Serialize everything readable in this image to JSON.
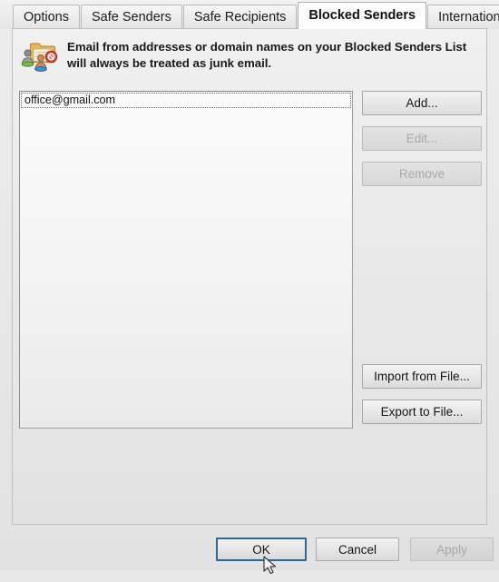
{
  "dialog": {
    "tabs": [
      {
        "label": "Options",
        "selected": false
      },
      {
        "label": "Safe Senders",
        "selected": false
      },
      {
        "label": "Safe Recipients",
        "selected": false
      },
      {
        "label": "Blocked Senders",
        "selected": true
      },
      {
        "label": "International",
        "selected": false
      }
    ],
    "header": {
      "icon": "blocked-senders-folder-icon",
      "description": "Email from addresses or domain names on your Blocked Senders List will always be treated as junk email."
    },
    "listbox": {
      "name": "blocked-senders-list",
      "items": [
        {
          "value": "office@gmail.com",
          "focused": true
        }
      ]
    },
    "side_buttons": [
      {
        "id": "add",
        "label": "Add...",
        "enabled": true
      },
      {
        "id": "edit",
        "label": "Edit...",
        "enabled": false
      },
      {
        "id": "remove",
        "label": "Remove",
        "enabled": false
      },
      {
        "id": "import",
        "label": "Import from File...",
        "enabled": true
      },
      {
        "id": "export",
        "label": "Export to File...",
        "enabled": true
      }
    ],
    "footer_buttons": [
      {
        "id": "ok",
        "label": "OK",
        "enabled": true,
        "default": true
      },
      {
        "id": "cancel",
        "label": "Cancel",
        "enabled": true,
        "default": false
      },
      {
        "id": "apply",
        "label": "Apply",
        "enabled": false,
        "default": false
      }
    ],
    "colors": {
      "default_button_border": "#2a6a96",
      "panel_background": "#eaeaea",
      "selected_tab_background": "#fdfdfd",
      "disabled_text": "#a9a9a9"
    }
  }
}
